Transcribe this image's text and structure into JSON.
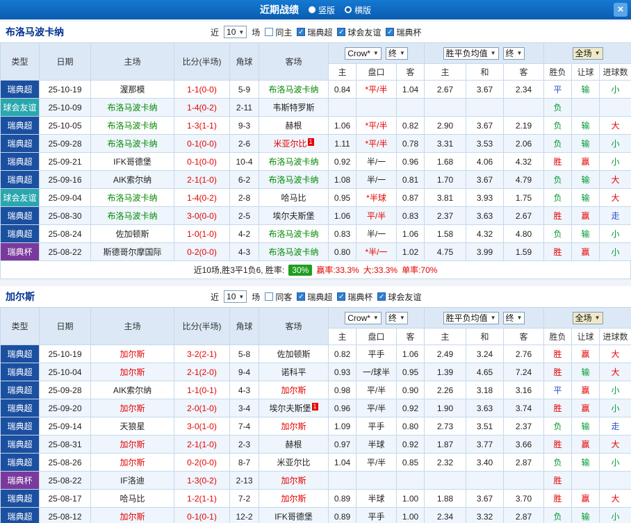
{
  "topbar": {
    "title": "近期战绩",
    "layout_vertical": "竖版",
    "layout_horizontal": "横版",
    "selected_layout": "横版"
  },
  "icons": {
    "chevron_down": "▼",
    "check": "✓",
    "close": "×"
  },
  "card_badge": "1",
  "colors": {
    "league": {
      "瑞典超": "#1b4fa0",
      "球会友谊": "#2aa7ae",
      "瑞典杯": "#7a3a9d"
    },
    "team_green": "#008800",
    "team_red": "#e60000",
    "score": "#e60000",
    "rate_badge_bg": "#1f9e1f"
  },
  "outcome_colors": {
    "胜": "#e60000",
    "赢": "#e60000",
    "大": "#e60000",
    "负": "#009933",
    "输": "#009933",
    "小": "#009933",
    "平": "#2b50c8",
    "走": "#2b50c8"
  },
  "table_header": {
    "cols": [
      "类型",
      "日期",
      "主场",
      "比分(半场)",
      "角球",
      "客场"
    ],
    "company_select": "Crow*",
    "final_select": "终",
    "avg_select": "胜平负均值",
    "final_select2": "终",
    "scope_select": "全场",
    "sub": [
      "主",
      "盘口",
      "客",
      "主",
      "和",
      "客",
      "胜负",
      "让球",
      "进球数"
    ]
  },
  "sections": [
    {
      "team": "布洛马波卡纳",
      "filter": {
        "near_label": "近",
        "count": "10",
        "matches_label": "场",
        "venue_label": "同主",
        "venue_checked": false,
        "leagues": [
          {
            "label": "瑞典超",
            "checked": true
          },
          {
            "label": "球会友谊",
            "checked": true
          },
          {
            "label": "瑞典杯",
            "checked": true
          }
        ]
      },
      "rows": [
        {
          "lg": "瑞典超",
          "date": "25-10-19",
          "home": "渥那模",
          "hc": "",
          "score": "1-1(0-0)",
          "corner": "5-9",
          "away": "布洛马波卡纳",
          "ac": "green",
          "ah": "0.84",
          "hd": "*平/半",
          "hdred": true,
          "aa": "1.04",
          "eh": "2.67",
          "ed": "3.67",
          "ea": "2.34",
          "wdl": "平",
          "cover": "输",
          "ou": "小"
        },
        {
          "lg": "球会友谊",
          "date": "25-10-09",
          "home": "布洛马波卡纳",
          "hc": "green",
          "score": "1-4(0-2)",
          "corner": "2-11",
          "away": "韦斯特罗斯",
          "ac": "",
          "ah": "",
          "hd": "",
          "aa": "",
          "eh": "",
          "ed": "",
          "ea": "",
          "wdl": "负",
          "cover": "",
          "ou": ""
        },
        {
          "lg": "瑞典超",
          "date": "25-10-05",
          "home": "布洛马波卡纳",
          "hc": "green",
          "score": "1-3(1-1)",
          "corner": "9-3",
          "away": "赫根",
          "ac": "",
          "ah": "1.06",
          "hd": "*平/半",
          "hdred": true,
          "aa": "0.82",
          "eh": "2.90",
          "ed": "3.67",
          "ea": "2.19",
          "wdl": "负",
          "cover": "输",
          "ou": "大"
        },
        {
          "lg": "瑞典超",
          "date": "25-09-28",
          "home": "布洛马波卡纳",
          "hc": "green",
          "score": "0-1(0-0)",
          "corner": "2-6",
          "away": "米亚尔比",
          "ac": "red",
          "acard": true,
          "ah": "1.11",
          "hd": "*平/半",
          "hdred": true,
          "aa": "0.78",
          "eh": "3.31",
          "ed": "3.53",
          "ea": "2.06",
          "wdl": "负",
          "cover": "输",
          "ou": "小"
        },
        {
          "lg": "瑞典超",
          "date": "25-09-21",
          "home": "IFK哥德堡",
          "hc": "",
          "score": "0-1(0-0)",
          "corner": "10-4",
          "away": "布洛马波卡纳",
          "ac": "green",
          "ah": "0.92",
          "hd": "半/一",
          "aa": "0.96",
          "eh": "1.68",
          "ed": "4.06",
          "ea": "4.32",
          "wdl": "胜",
          "cover": "赢",
          "ou": "小"
        },
        {
          "lg": "瑞典超",
          "date": "25-09-16",
          "home": "AIK索尔纳",
          "hc": "",
          "score": "2-1(1-0)",
          "corner": "6-2",
          "away": "布洛马波卡纳",
          "ac": "green",
          "ah": "1.08",
          "hd": "半/一",
          "aa": "0.81",
          "eh": "1.70",
          "ed": "3.67",
          "ea": "4.79",
          "wdl": "负",
          "cover": "输",
          "ou": "大"
        },
        {
          "lg": "球会友谊",
          "date": "25-09-04",
          "home": "布洛马波卡纳",
          "hc": "green",
          "score": "1-4(0-2)",
          "corner": "2-8",
          "away": "哈马比",
          "ac": "",
          "ah": "0.95",
          "hd": "*半球",
          "hdred": true,
          "aa": "0.87",
          "eh": "3.81",
          "ed": "3.93",
          "ea": "1.75",
          "wdl": "负",
          "cover": "输",
          "ou": "大"
        },
        {
          "lg": "瑞典超",
          "date": "25-08-30",
          "home": "布洛马波卡纳",
          "hc": "green",
          "score": "3-0(0-0)",
          "corner": "2-5",
          "away": "埃尔夫斯堡",
          "ac": "",
          "ah": "1.06",
          "hd": "平/半",
          "hdred": true,
          "aa": "0.83",
          "eh": "2.37",
          "ed": "3.63",
          "ea": "2.67",
          "wdl": "胜",
          "cover": "赢",
          "ou": "走"
        },
        {
          "lg": "瑞典超",
          "date": "25-08-24",
          "home": "佐加顿斯",
          "hc": "",
          "score": "1-0(1-0)",
          "corner": "4-2",
          "away": "布洛马波卡纳",
          "ac": "green",
          "ah": "0.83",
          "hd": "半/一",
          "aa": "1.06",
          "eh": "1.58",
          "ed": "4.32",
          "ea": "4.80",
          "wdl": "负",
          "cover": "输",
          "ou": "小"
        },
        {
          "lg": "瑞典杯",
          "date": "25-08-22",
          "home": "斯德哥尔摩国际",
          "hc": "",
          "score": "0-2(0-0)",
          "corner": "4-3",
          "away": "布洛马波卡纳",
          "ac": "green",
          "ah": "0.80",
          "hd": "*半/一",
          "hdred": true,
          "aa": "1.02",
          "eh": "4.75",
          "ed": "3.99",
          "ea": "1.59",
          "wdl": "胜",
          "cover": "赢",
          "ou": "小"
        }
      ],
      "summary": {
        "prefix": "近10场,胜3平1负6, 胜率:",
        "win_rate": "30%",
        "stats": [
          "赢率:33.3%",
          "大:33.3%",
          "单率:70%"
        ]
      }
    },
    {
      "team": "加尔斯",
      "filter": {
        "near_label": "近",
        "count": "10",
        "matches_label": "场",
        "venue_label": "同客",
        "venue_checked": false,
        "leagues": [
          {
            "label": "瑞典超",
            "checked": true
          },
          {
            "label": "瑞典杯",
            "checked": true
          },
          {
            "label": "球会友谊",
            "checked": true
          }
        ]
      },
      "rows": [
        {
          "lg": "瑞典超",
          "date": "25-10-19",
          "home": "加尔斯",
          "hc": "red",
          "score": "3-2(2-1)",
          "corner": "5-8",
          "away": "佐加顿斯",
          "ac": "",
          "ah": "0.82",
          "hd": "平手",
          "aa": "1.06",
          "eh": "2.49",
          "ed": "3.24",
          "ea": "2.76",
          "wdl": "胜",
          "cover": "赢",
          "ou": "大"
        },
        {
          "lg": "瑞典超",
          "date": "25-10-04",
          "home": "加尔斯",
          "hc": "red",
          "score": "2-1(2-0)",
          "corner": "9-4",
          "away": "诺科平",
          "ac": "",
          "ah": "0.93",
          "hd": "一/球半",
          "aa": "0.95",
          "eh": "1.39",
          "ed": "4.65",
          "ea": "7.24",
          "wdl": "胜",
          "cover": "输",
          "ou": "大"
        },
        {
          "lg": "瑞典超",
          "date": "25-09-28",
          "home": "AIK索尔纳",
          "hc": "",
          "score": "1-1(0-1)",
          "corner": "4-3",
          "away": "加尔斯",
          "ac": "red",
          "ah": "0.98",
          "hd": "平/半",
          "aa": "0.90",
          "eh": "2.26",
          "ed": "3.18",
          "ea": "3.16",
          "wdl": "平",
          "cover": "赢",
          "ou": "小"
        },
        {
          "lg": "瑞典超",
          "date": "25-09-20",
          "home": "加尔斯",
          "hc": "red",
          "score": "2-0(1-0)",
          "corner": "3-4",
          "away": "埃尔夫斯堡",
          "ac": "",
          "acard": true,
          "ah": "0.96",
          "hd": "平/半",
          "aa": "0.92",
          "eh": "1.90",
          "ed": "3.63",
          "ea": "3.74",
          "wdl": "胜",
          "cover": "赢",
          "ou": "小"
        },
        {
          "lg": "瑞典超",
          "date": "25-09-14",
          "home": "天狼星",
          "hc": "",
          "score": "3-0(1-0)",
          "corner": "7-4",
          "away": "加尔斯",
          "ac": "red",
          "ah": "1.09",
          "hd": "平手",
          "aa": "0.80",
          "eh": "2.73",
          "ed": "3.51",
          "ea": "2.37",
          "wdl": "负",
          "cover": "输",
          "ou": "走"
        },
        {
          "lg": "瑞典超",
          "date": "25-08-31",
          "home": "加尔斯",
          "hc": "red",
          "score": "2-1(1-0)",
          "corner": "2-3",
          "away": "赫根",
          "ac": "",
          "ah": "0.97",
          "hd": "半球",
          "aa": "0.92",
          "eh": "1.87",
          "ed": "3.77",
          "ea": "3.66",
          "wdl": "胜",
          "cover": "赢",
          "ou": "大"
        },
        {
          "lg": "瑞典超",
          "date": "25-08-26",
          "home": "加尔斯",
          "hc": "red",
          "score": "0-2(0-0)",
          "corner": "8-7",
          "away": "米亚尔比",
          "ac": "",
          "ah": "1.04",
          "hd": "平/半",
          "aa": "0.85",
          "eh": "2.32",
          "ed": "3.40",
          "ea": "2.87",
          "wdl": "负",
          "cover": "输",
          "ou": "小"
        },
        {
          "lg": "瑞典杯",
          "date": "25-08-22",
          "home": "IF洛迪",
          "hc": "",
          "score": "1-3(0-2)",
          "corner": "2-13",
          "away": "加尔斯",
          "ac": "red",
          "ah": "",
          "hd": "",
          "aa": "",
          "eh": "",
          "ed": "",
          "ea": "",
          "wdl": "胜",
          "cover": "",
          "ou": ""
        },
        {
          "lg": "瑞典超",
          "date": "25-08-17",
          "home": "哈马比",
          "hc": "",
          "score": "1-2(1-1)",
          "corner": "7-2",
          "away": "加尔斯",
          "ac": "red",
          "ah": "0.89",
          "hd": "半球",
          "aa": "1.00",
          "eh": "1.88",
          "ed": "3.67",
          "ea": "3.70",
          "wdl": "胜",
          "cover": "赢",
          "ou": "大"
        },
        {
          "lg": "瑞典超",
          "date": "25-08-12",
          "home": "加尔斯",
          "hc": "red",
          "score": "0-1(0-1)",
          "corner": "12-2",
          "away": "IFK哥德堡",
          "ac": "",
          "ah": "0.89",
          "hd": "平手",
          "aa": "1.00",
          "eh": "2.34",
          "ed": "3.32",
          "ea": "2.87",
          "wdl": "负",
          "cover": "输",
          "ou": "小"
        }
      ]
    }
  ]
}
